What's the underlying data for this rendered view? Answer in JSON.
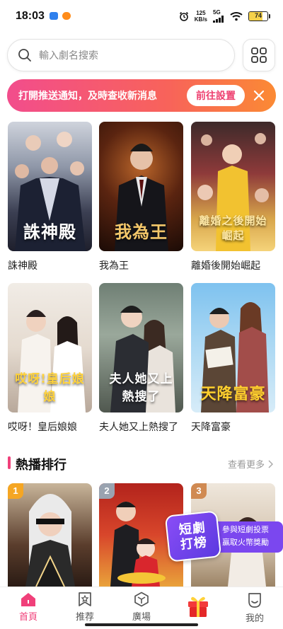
{
  "status_bar": {
    "time": "18:03",
    "net_speed_value": "125",
    "net_speed_unit": "KB/s",
    "network": "5G",
    "battery": "74"
  },
  "search": {
    "placeholder": "輸入劇名搜索"
  },
  "notice": {
    "text": "打開推送通知，及時查收新消息",
    "button": "前往設置"
  },
  "posters": [
    {
      "title": "誅神殿",
      "caption": "誅神殿",
      "caption_color": "#ffffff"
    },
    {
      "title": "我為王",
      "caption": "我為王",
      "caption_color": "#f3c76a"
    },
    {
      "title": "離婚後開始崛起",
      "caption": "離婚之後開始崛起",
      "caption_color": "#ffe9a6"
    },
    {
      "title": "哎呀！皇后娘娘",
      "caption": "哎呀!皇后娘娘",
      "caption_color": "#ffd23a"
    },
    {
      "title": "夫人她又上熱搜了",
      "caption": "夫人她又上熱搜了",
      "caption_color": "#ffffff"
    },
    {
      "title": "天降富豪",
      "caption": "天降富豪",
      "caption_color": "#ffcf2e"
    }
  ],
  "section": {
    "title": "熱播排行",
    "see_more": "查看更多"
  },
  "ranking": [
    {
      "rank": "1",
      "badge_color": "#f5a623"
    },
    {
      "rank": "2",
      "badge_color": "#9aa3b0"
    },
    {
      "rank": "3",
      "badge_color": "#d08a52"
    }
  ],
  "promo": {
    "badge_line1": "短劇",
    "badge_line2": "打榜",
    "line1": "參與短劇投票",
    "line2": "贏取火幣獎勵"
  },
  "nav": [
    {
      "label": "首頁",
      "active": true
    },
    {
      "label": "推荐",
      "active": false
    },
    {
      "label": "廣場",
      "active": false
    },
    {
      "label": "",
      "active": false
    },
    {
      "label": "我的",
      "active": false
    }
  ],
  "colors": {
    "accent": "#f0407a",
    "notice_gradient_start": "#f24d8c",
    "notice_gradient_end": "#fb8a34"
  }
}
